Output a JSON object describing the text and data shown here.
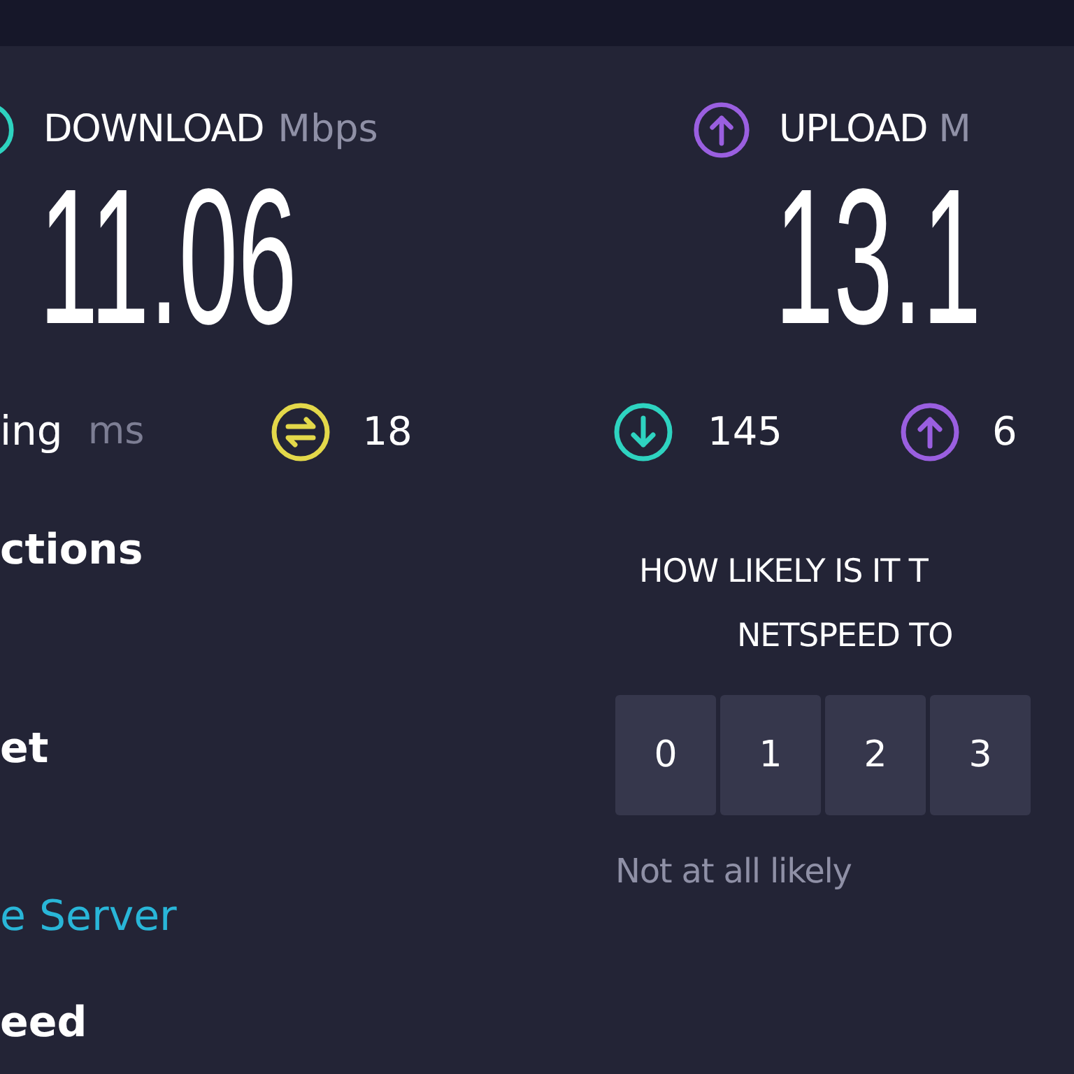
{
  "download": {
    "label": "DOWNLOAD",
    "unit": "Mbps",
    "value": "11.06"
  },
  "upload": {
    "label": "UPLOAD",
    "unit": "M",
    "value": "13.1"
  },
  "ping": {
    "label": "ing",
    "unit": "ms",
    "jitter": "18",
    "download_latency": "145",
    "upload_latency": "6"
  },
  "menu": [
    {
      "label": "ctions",
      "kind": "heading"
    },
    {
      "label": "et",
      "kind": "heading"
    },
    {
      "label": "e Server",
      "kind": "link"
    },
    {
      "label": "eed",
      "kind": "heading"
    }
  ],
  "survey": {
    "question_lines": [
      "HOW LIKELY IS IT T",
      "NETSPEED TO"
    ],
    "options": [
      {
        "label": "0",
        "selected": false
      },
      {
        "label": "1",
        "selected": false
      },
      {
        "label": "2",
        "selected": false
      },
      {
        "label": "3",
        "selected": false
      }
    ],
    "low_label": "Not at all likely"
  }
}
